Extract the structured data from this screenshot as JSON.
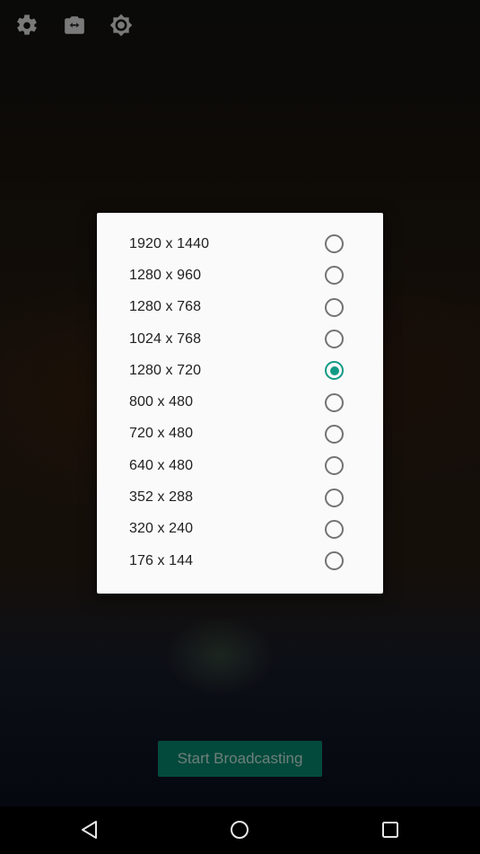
{
  "top_bar": {
    "icons": [
      {
        "name": "settings-icon"
      },
      {
        "name": "switch-camera-icon"
      },
      {
        "name": "brightness-icon"
      }
    ]
  },
  "resolution_dialog": {
    "selected": "1280 x 720",
    "options": [
      {
        "label": "1920 x 1440",
        "checked": false
      },
      {
        "label": "1280 x 960",
        "checked": false
      },
      {
        "label": "1280 x 768",
        "checked": false
      },
      {
        "label": "1024 x 768",
        "checked": false
      },
      {
        "label": "1280 x 720",
        "checked": true
      },
      {
        "label": "800 x 480",
        "checked": false
      },
      {
        "label": "720 x 480",
        "checked": false
      },
      {
        "label": "640 x 480",
        "checked": false
      },
      {
        "label": "352 x 288",
        "checked": false
      },
      {
        "label": "320 x 240",
        "checked": false
      },
      {
        "label": "176 x 144",
        "checked": false
      }
    ]
  },
  "broadcast_button": {
    "label": "Start Broadcasting"
  },
  "colors": {
    "accent": "#119a86",
    "button_bg": "#034a3c",
    "dialog_bg": "#fafafa"
  },
  "nav_bar": {
    "buttons": [
      {
        "name": "back-icon"
      },
      {
        "name": "home-icon"
      },
      {
        "name": "recents-icon"
      }
    ]
  }
}
